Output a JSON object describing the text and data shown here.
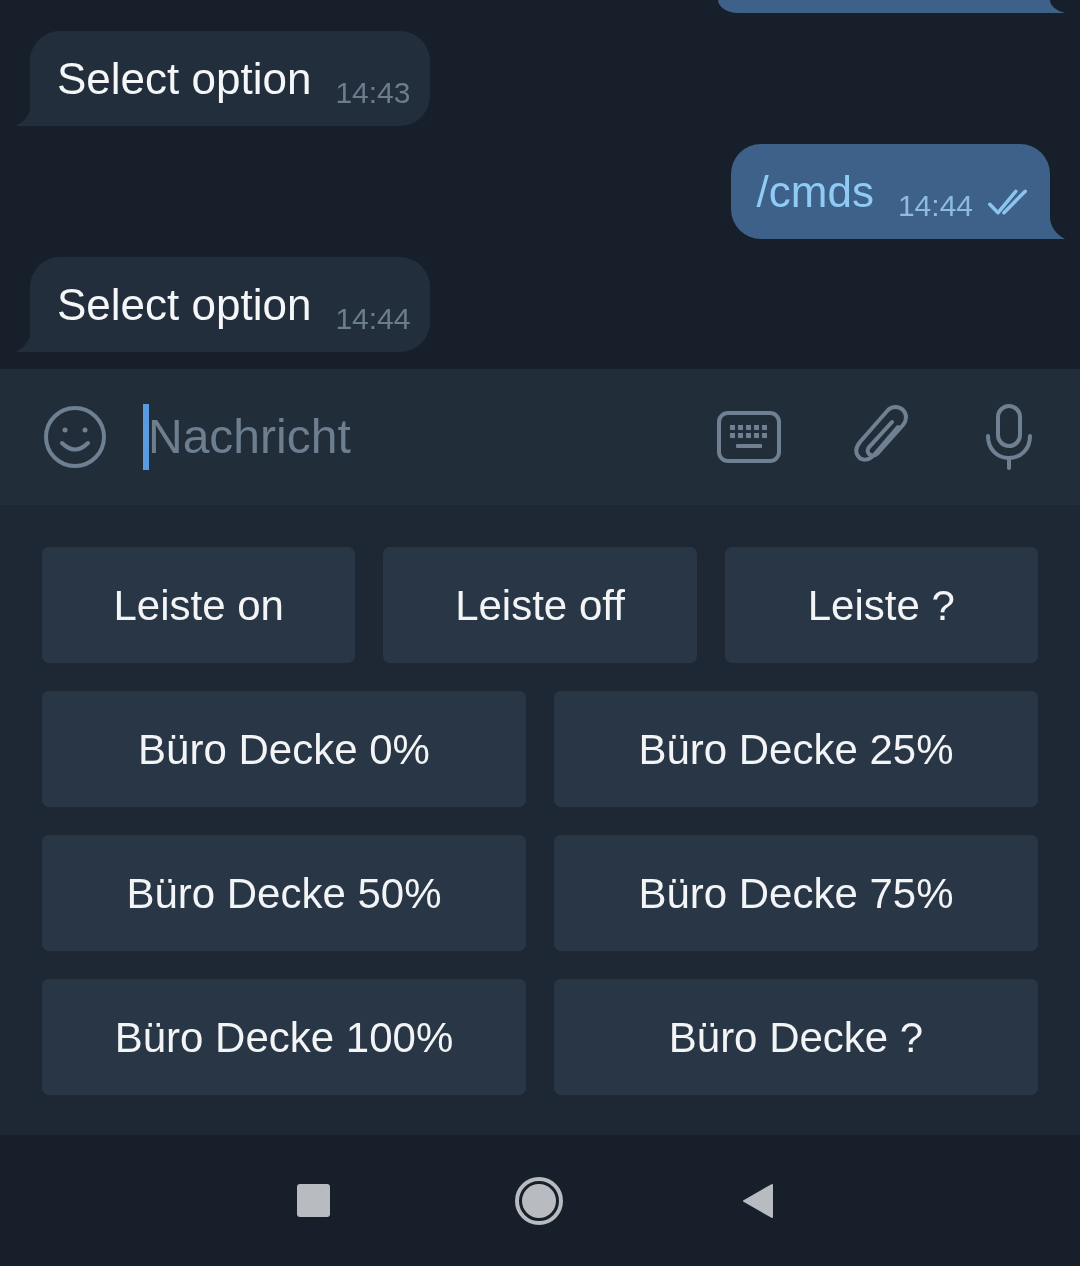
{
  "messages": [
    {
      "kind": "incoming",
      "text": "Select option",
      "time": "14:43"
    },
    {
      "kind": "outgoing",
      "text": "/cmds",
      "time": "14:44",
      "read": true
    },
    {
      "kind": "incoming",
      "text": "Select option",
      "time": "14:44"
    }
  ],
  "composer": {
    "placeholder": "Nachricht"
  },
  "keyboard": {
    "rows": [
      {
        "buttons": [
          "Leiste on",
          "Leiste off",
          "Leiste ?"
        ]
      },
      {
        "buttons": [
          "Büro Decke 0%",
          "Büro Decke 25%"
        ]
      },
      {
        "buttons": [
          "Büro Decke 50%",
          "Büro Decke 75%"
        ]
      },
      {
        "buttons": [
          "Büro Decke 100%",
          "Büro Decke ?"
        ]
      }
    ]
  }
}
